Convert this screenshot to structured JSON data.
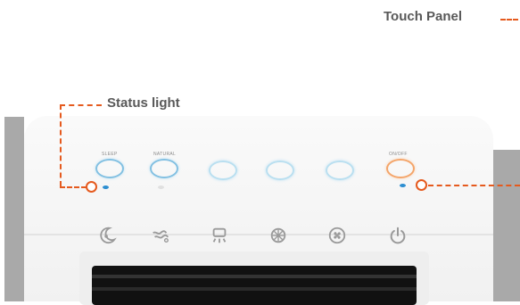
{
  "labels": {
    "touch_panel": "Touch Panel",
    "status_light": "Status light"
  },
  "panel": {
    "buttons": [
      {
        "label": "SLEEP",
        "ring": "blue",
        "light": "on"
      },
      {
        "label": "NATURAL",
        "ring": "blue",
        "light": "off"
      },
      {
        "label": "",
        "ring": "soft",
        "light": "none"
      },
      {
        "label": "",
        "ring": "soft",
        "light": "none"
      },
      {
        "label": "",
        "ring": "soft",
        "light": "none"
      },
      {
        "label": "ON/OFF",
        "ring": "orange",
        "light": "on"
      }
    ],
    "icons": [
      "sleep-moon-icon",
      "natural-wind-icon",
      "cooling-icon",
      "ice-crystal-icon",
      "fan-speed-icon",
      "power-icon"
    ]
  },
  "colors": {
    "accent": "#e55a1e",
    "label_text": "#595959",
    "status_led": "#2e8fd1",
    "ring_blue": "#82c0e2",
    "ring_orange": "#f4a56a"
  }
}
